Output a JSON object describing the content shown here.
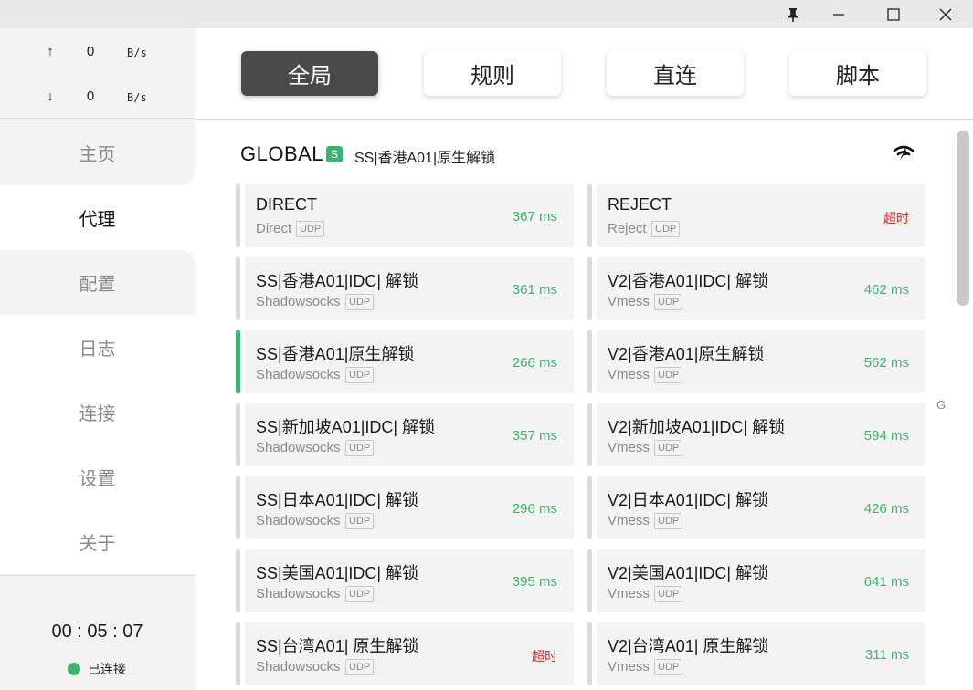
{
  "titlebar": {
    "icons": [
      "pin-icon",
      "minimize-icon",
      "maximize-icon",
      "close-icon"
    ]
  },
  "traffic": {
    "up_arrow": "↑",
    "up_value": "0",
    "up_unit": "B/s",
    "down_arrow": "↓",
    "down_value": "0",
    "down_unit": "B/s"
  },
  "sidebar": {
    "items": [
      {
        "label": "主页"
      },
      {
        "label": "代理"
      },
      {
        "label": "配置"
      },
      {
        "label": "日志"
      },
      {
        "label": "连接"
      },
      {
        "label": "设置"
      },
      {
        "label": "关于"
      }
    ],
    "active_index": 1,
    "timer": "00 : 05 : 07",
    "status": "已连接"
  },
  "modes": [
    {
      "label": "全局",
      "active": true
    },
    {
      "label": "规则",
      "active": false
    },
    {
      "label": "直连",
      "active": false
    },
    {
      "label": "脚本",
      "active": false
    }
  ],
  "group": {
    "name": "GLOBAL",
    "badge": "S",
    "selected": "SS|香港A01|原生解锁"
  },
  "proxies": [
    {
      "name": "DIRECT",
      "type": "Direct",
      "udp": "UDP",
      "delay": "367 ms",
      "timeout": false,
      "selected": false
    },
    {
      "name": "REJECT",
      "type": "Reject",
      "udp": "UDP",
      "delay": "超时",
      "timeout": true,
      "selected": false
    },
    {
      "name": "SS|香港A01|IDC| 解锁",
      "type": "Shadowsocks",
      "udp": "UDP",
      "delay": "361 ms",
      "timeout": false,
      "selected": false
    },
    {
      "name": "V2|香港A01|IDC| 解锁",
      "type": "Vmess",
      "udp": "UDP",
      "delay": "462 ms",
      "timeout": false,
      "selected": false
    },
    {
      "name": "SS|香港A01|原生解锁",
      "type": "Shadowsocks",
      "udp": "UDP",
      "delay": "266 ms",
      "timeout": false,
      "selected": true
    },
    {
      "name": "V2|香港A01|原生解锁",
      "type": "Vmess",
      "udp": "UDP",
      "delay": "562 ms",
      "timeout": false,
      "selected": false
    },
    {
      "name": "SS|新加坡A01|IDC| 解锁",
      "type": "Shadowsocks",
      "udp": "UDP",
      "delay": "357 ms",
      "timeout": false,
      "selected": false
    },
    {
      "name": "V2|新加坡A01|IDC| 解锁",
      "type": "Vmess",
      "udp": "UDP",
      "delay": "594 ms",
      "timeout": false,
      "selected": false
    },
    {
      "name": "SS|日本A01|IDC| 解锁",
      "type": "Shadowsocks",
      "udp": "UDP",
      "delay": "296 ms",
      "timeout": false,
      "selected": false
    },
    {
      "name": "V2|日本A01|IDC| 解锁",
      "type": "Vmess",
      "udp": "UDP",
      "delay": "426 ms",
      "timeout": false,
      "selected": false
    },
    {
      "name": "SS|美国A01|IDC| 解锁",
      "type": "Shadowsocks",
      "udp": "UDP",
      "delay": "395 ms",
      "timeout": false,
      "selected": false
    },
    {
      "name": "V2|美国A01|IDC| 解锁",
      "type": "Vmess",
      "udp": "UDP",
      "delay": "641 ms",
      "timeout": false,
      "selected": false
    },
    {
      "name": "SS|台湾A01| 原生解锁",
      "type": "Shadowsocks",
      "udp": "UDP",
      "delay": "超时",
      "timeout": true,
      "selected": false
    },
    {
      "name": "V2|台湾A01| 原生解锁",
      "type": "Vmess",
      "udp": "UDP",
      "delay": "311 ms",
      "timeout": false,
      "selected": false
    }
  ],
  "side_letter": "G",
  "colors": {
    "accent": "#3cb371",
    "timeout": "#d62828",
    "active_mode": "#4a4a4a"
  }
}
